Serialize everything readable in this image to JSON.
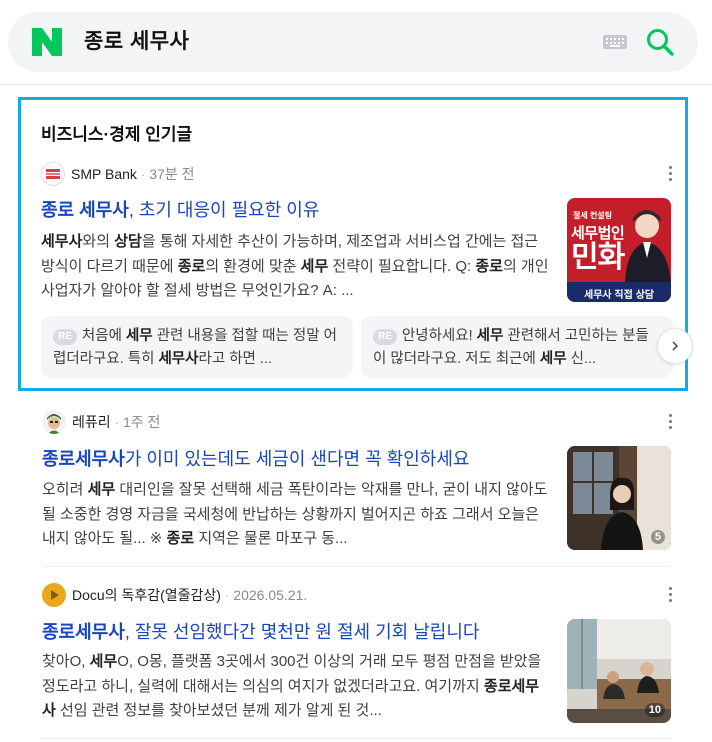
{
  "search": {
    "query": "종로 세무사"
  },
  "colors": {
    "brand": "#03c75a",
    "link": "#1946b8",
    "card_border": "#12abe3"
  },
  "popular": {
    "title": "비즈니스·경제 인기글",
    "post": {
      "source": "SMP Bank",
      "time": "37분 전",
      "title_bold": "종로 세무사",
      "title_rest": ", 초기 대응이 필요한 이유",
      "body": [
        {
          "b": "세무사"
        },
        {
          "t": "와의 "
        },
        {
          "b": "상담"
        },
        {
          "t": "을 통해 자세한 추산이 가능하며, 제조업과 서비스업 간에는 접근방식이 다르기 때문에 "
        },
        {
          "b": "종로"
        },
        {
          "t": "의 환경에 맞춘 "
        },
        {
          "b": "세무"
        },
        {
          "t": " 전략이 필요합니다. Q: "
        },
        {
          "b": "종로"
        },
        {
          "t": "의 개인 사업자가 알아야 할 절세 방법은 무엇인가요? A: ..."
        }
      ],
      "thumb": {
        "small_caption": "절세 컨설팅",
        "headline": "세무법인",
        "big": "민화",
        "bottom": "세무사 직접 상담"
      }
    },
    "replies": [
      {
        "tag": "RE",
        "parts": [
          {
            "t": "처음에 "
          },
          {
            "b": "세무"
          },
          {
            "t": " 관련 내용을 접할 때는 정말 어렵더라구요. 특히 "
          },
          {
            "b": "세무사"
          },
          {
            "t": "라고 하면 ..."
          }
        ]
      },
      {
        "tag": "RE",
        "parts": [
          {
            "t": "안녕하세요! "
          },
          {
            "b": "세무"
          },
          {
            "t": " 관련해서 고민하는 분들이 많더라구요. 저도 최근에 "
          },
          {
            "b": "세무"
          },
          {
            "t": " 신..."
          }
        ]
      }
    ]
  },
  "results": [
    {
      "source": "레퓨리",
      "time": "1주 전",
      "title_bold": "종로세무사",
      "title_rest": "가 이미 있는데도 세금이 샌다면 꼭 확인하세요",
      "body": [
        {
          "t": "오히려 "
        },
        {
          "b": "세무"
        },
        {
          "t": " 대리인을 잘못 선택해 세금 폭탄이라는 악재를 만나, 굳이 내지 않아도 될 소중한 경영 자금을 국세청에 반납하는 상황까지 벌어지곤 하죠 그래서 오늘은 내지 않아도 될... ※ "
        },
        {
          "b": "종로"
        },
        {
          "t": " 지역은 물론 마포구 동..."
        }
      ],
      "image_count": "5"
    },
    {
      "source": "Docu의 독후감(열줄감상)",
      "time": "2026.05.21.",
      "title_bold": "종로세무사",
      "title_rest": ", 잘못 선임했다간 몇천만 원 절세 기회 날립니다",
      "body": [
        {
          "t": "찾아O, "
        },
        {
          "b": "세무"
        },
        {
          "t": "O, O몽, 플랫폼 3곳에서 300건 이상의 거래 모두 평점 만점을 받았을 정도라고 하니, 실력에 대해서는 의심의 여지가 없겠더라고요. 여기까지 "
        },
        {
          "b": "종로세무사"
        },
        {
          "t": " 선임 관련 정보를 찾아보셨던 분께 제가 알게 된 것..."
        }
      ],
      "image_count": "10"
    }
  ]
}
